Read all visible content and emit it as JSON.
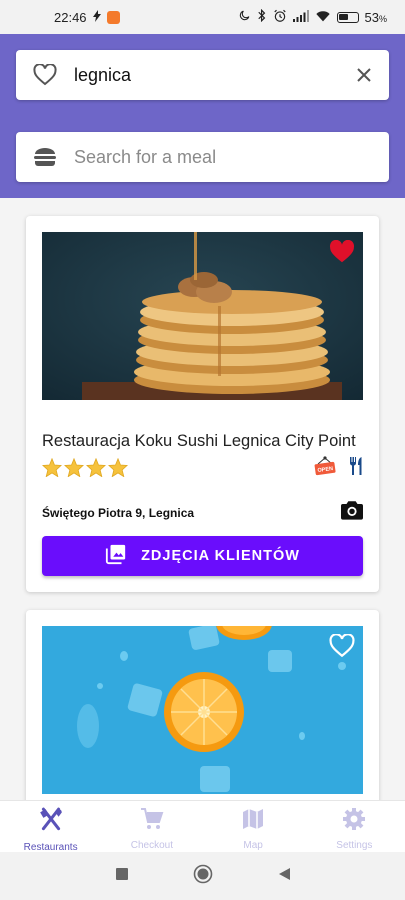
{
  "status_bar": {
    "time": "22:46",
    "battery": "53",
    "battery_suffix": "%",
    "battery_level": 0.53
  },
  "search": {
    "city_value": "legnica",
    "meal_placeholder": "Search for a meal"
  },
  "restaurants": [
    {
      "name": "Restauracja Koku Sushi Legnica City Point",
      "rating": 4,
      "address": "Świętego Piotra 9, Legnica",
      "open_label": "OPEN",
      "photos_button": "ZDJĘCIA KLIENTÓW",
      "favorite": true
    },
    {
      "favorite": false
    }
  ],
  "nav": {
    "items": [
      {
        "label": "Restaurants",
        "icon": "utensils-icon"
      },
      {
        "label": "Checkout",
        "icon": "cart-icon"
      },
      {
        "label": "Map",
        "icon": "map-icon"
      },
      {
        "label": "Settings",
        "icon": "gear-icon"
      }
    ],
    "active": 0
  },
  "colors": {
    "header": "#6e66c8",
    "accent_button": "#6a0dfc",
    "favorite": "#e0102a",
    "nav_active": "#5a52b8",
    "nav_inactive": "#c5c3e6"
  }
}
